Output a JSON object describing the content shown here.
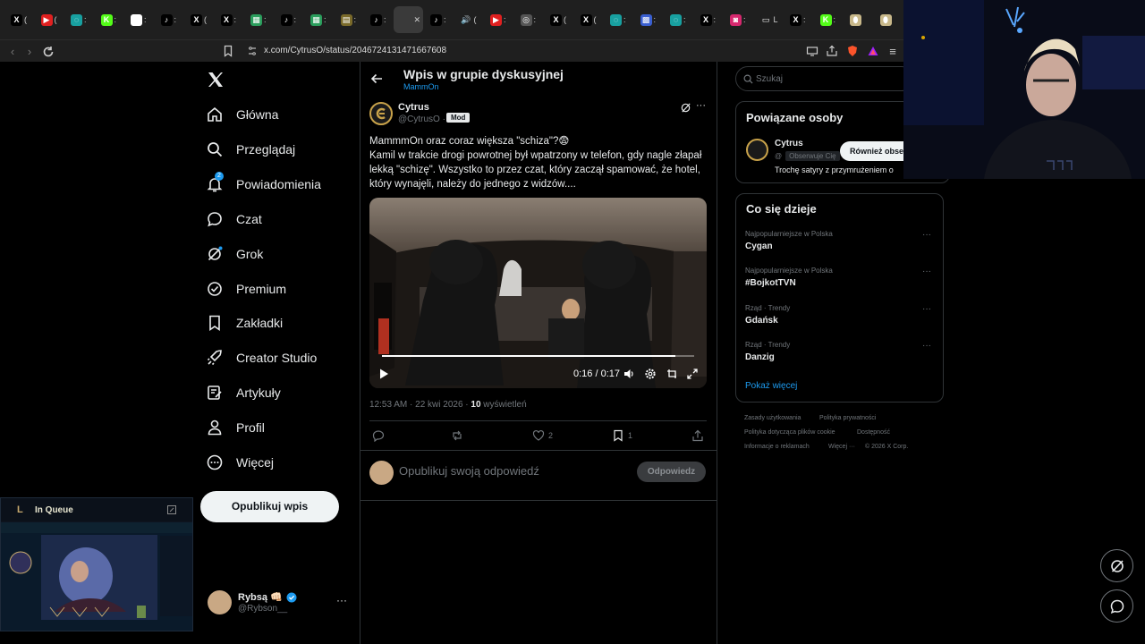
{
  "browser": {
    "tabs": [
      {
        "icon": "x-icon",
        "glyph": "X",
        "color": "#000",
        "label": "("
      },
      {
        "icon": "youtube-icon",
        "glyph": "▶",
        "color": "#e02020",
        "label": "("
      },
      {
        "icon": "cycle-icon",
        "glyph": "◌",
        "color": "#18a0a0",
        "label": ":"
      },
      {
        "icon": "kick-icon",
        "glyph": "K",
        "color": "#53fc18",
        "label": ":"
      },
      {
        "icon": "google-icon",
        "glyph": "G",
        "color": "#fff",
        "label": ":"
      },
      {
        "icon": "tiktok-icon",
        "glyph": "♪",
        "color": "#000",
        "label": ":"
      },
      {
        "icon": "x-icon",
        "glyph": "X",
        "color": "#000",
        "label": "("
      },
      {
        "icon": "x-icon",
        "glyph": "X",
        "color": "#000",
        "label": ":"
      },
      {
        "icon": "sheets-icon",
        "glyph": "▦",
        "color": "#2a9d5c",
        "label": ":"
      },
      {
        "icon": "tiktok-icon",
        "glyph": "♪",
        "color": "#000",
        "label": ":"
      },
      {
        "icon": "sheets-icon",
        "glyph": "▦",
        "color": "#2a9d5c",
        "label": ":"
      },
      {
        "icon": "doc-icon",
        "glyph": "▤",
        "color": "#7a6a2a",
        "label": ":"
      },
      {
        "icon": "tiktok-icon",
        "glyph": "♪",
        "color": "#000",
        "label": ":"
      },
      {
        "icon": "blank-icon",
        "glyph": "",
        "color": "#3a3a3a",
        "label": "✕"
      },
      {
        "icon": "tiktok-icon",
        "glyph": "♪",
        "color": "#000",
        "label": ":"
      },
      {
        "icon": "speaker-icon",
        "glyph": "🔊",
        "color": "#1f1f1f",
        "label": "("
      },
      {
        "icon": "youtube-icon",
        "glyph": "▶",
        "color": "#e02020",
        "label": ":"
      },
      {
        "icon": "app-icon",
        "glyph": "◎",
        "color": "#555",
        "label": ":"
      },
      {
        "icon": "x-icon",
        "glyph": "X",
        "color": "#000",
        "label": "("
      },
      {
        "icon": "x-icon",
        "glyph": "X",
        "color": "#000",
        "label": "("
      },
      {
        "icon": "cycle-icon",
        "glyph": "◌",
        "color": "#18a0a0",
        "label": ":"
      },
      {
        "icon": "grid-icon",
        "glyph": "▩",
        "color": "#3a5fd0",
        "label": ":"
      },
      {
        "icon": "cycle-icon",
        "glyph": "◌",
        "color": "#18a0a0",
        "label": ":"
      },
      {
        "icon": "x-icon",
        "glyph": "X",
        "color": "#000",
        "label": ":"
      },
      {
        "icon": "instagram-icon",
        "glyph": "◙",
        "color": "#d6286e",
        "label": ":"
      },
      {
        "icon": "link-icon",
        "glyph": "▭",
        "color": "#1f1f1f",
        "label": "L"
      },
      {
        "icon": "x-icon",
        "glyph": "X",
        "color": "#000",
        "label": ":"
      },
      {
        "icon": "kick-icon",
        "glyph": "K",
        "color": "#53fc18",
        "label": ":"
      },
      {
        "icon": "egg-icon",
        "glyph": "⬮",
        "color": "#c8b88a",
        "label": ""
      },
      {
        "icon": "egg-icon",
        "glyph": "⬮",
        "color": "#c8b88a",
        "label": ""
      }
    ],
    "url": "x.com/CytrusO/status/2046724131471667608"
  },
  "nav": {
    "items": [
      {
        "label": "Główna",
        "icon": "home-icon"
      },
      {
        "label": "Przeglądaj",
        "icon": "search-icon"
      },
      {
        "label": "Powiadomienia",
        "icon": "bell-icon",
        "badge": "2"
      },
      {
        "label": "Czat",
        "icon": "chat-icon"
      },
      {
        "label": "Grok",
        "icon": "grok-icon"
      },
      {
        "label": "Premium",
        "icon": "premium-icon"
      },
      {
        "label": "Zakładki",
        "icon": "bookmark-icon"
      },
      {
        "label": "Creator Studio",
        "icon": "rocket-icon"
      },
      {
        "label": "Artykuły",
        "icon": "article-icon"
      },
      {
        "label": "Profil",
        "icon": "person-icon"
      },
      {
        "label": "Więcej",
        "icon": "more-icon"
      }
    ],
    "post_button": "Opublikuj wpis",
    "account": {
      "name": "Rybsą 👊🏻",
      "handle": "@Rybson__"
    }
  },
  "post": {
    "header_title": "Wpis w grupie dyskusyjnej",
    "header_sub": "MammOn",
    "author_name": "Cytrus",
    "author_handle": "@CytrusO ·",
    "badge": "Mod",
    "text_line1": "MammmOn oraz coraz większa \"schiza\"?😨",
    "text_line2": "Kamil w trakcie drogi powrotnej był wpatrzony w telefon, gdy nagle złapał lekką \"schizę\". Wszystko to przez czat, który zaczął spamować, że hotel, który wynajęli, należy do jednego z widzów....",
    "video_time": "0:16 / 0:17",
    "video_progress": 0.94,
    "meta_date": "12:53 AM · 22 kwi 2026 · ",
    "meta_views_count": "10",
    "meta_views_label": " wyświetleń",
    "actions": {
      "likes": "2",
      "bookmarks": "1"
    },
    "reply_placeholder": "Opublikuj swoją odpowiedź",
    "reply_button": "Odpowiedz"
  },
  "sidebar": {
    "search_placeholder": "Szukaj",
    "people_title": "Powiązane osoby",
    "person_name": "Cytrus",
    "person_handle_prefix": "@",
    "person_follows_badge": "Obserwuje Cię",
    "person_follow_button": "Również obse",
    "person_bio": "Trochę satyry z przymrużeniem o",
    "trends_title": "Co się dzieje",
    "trends": [
      {
        "category": "Najpopularniejsze w Polska",
        "name": "Cygan"
      },
      {
        "category": "Najpopularniejsze w Polska",
        "name": "#BojkotTVN"
      },
      {
        "category": "Rząd · Trendy",
        "name": "Gdańsk"
      },
      {
        "category": "Rząd · Trendy",
        "name": "Danzig"
      }
    ],
    "show_more": "Pokaż więcej",
    "footer": [
      "Zasady użytkowania",
      "Polityka prywatności",
      "Polityka dotycząca plików cookie",
      "Dostępność",
      "Informacje o reklamach",
      "Więcej ···",
      "© 2026 X Corp."
    ]
  },
  "overlay": {
    "queue_title": "In Queue"
  },
  "colors": {
    "accent": "#1d9bf0",
    "bg": "#000000",
    "border": "#2f3336",
    "muted": "#71767b"
  }
}
